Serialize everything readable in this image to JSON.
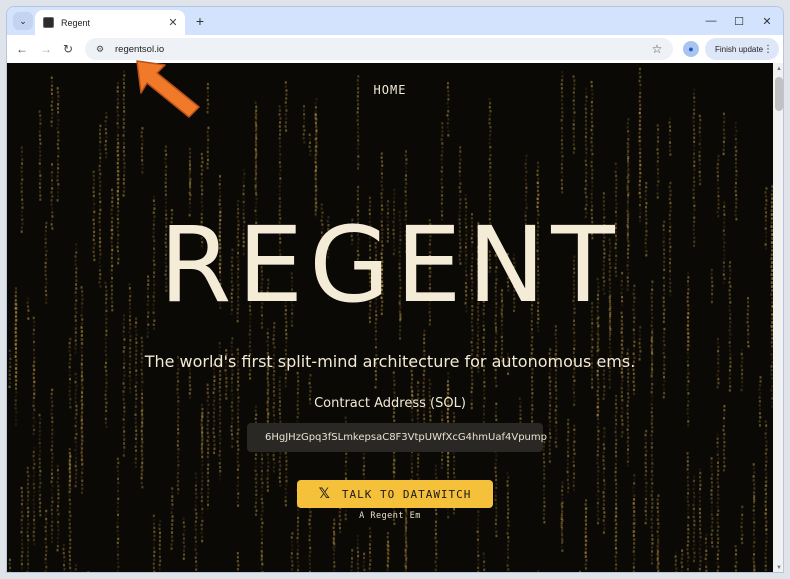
{
  "browser": {
    "tab_title": "Regent",
    "url": "regentsol.io",
    "finish_update_label": "Finish update",
    "icons": {
      "tab_search": "chevron-down-icon",
      "new_tab": "plus-icon",
      "back": "arrow-left-icon",
      "forward": "arrow-right-icon",
      "reload": "reload-icon",
      "site_settings": "tune-icon",
      "bookmark": "star-icon",
      "profile": "person-icon",
      "menu": "kebab-icon"
    }
  },
  "page": {
    "nav_home": "HOME",
    "title": "REGENT",
    "tagline": "The world's first split-mind architecture for autonomous ems.",
    "contract_label": "Contract Address (SOL)",
    "contract_address": "6HgJHzGpq3fSLmkepsaC8F3VtpUWfXcG4hmUaf4Vpump",
    "cta_label": "TALK TO DATAWITCH",
    "cta_sub": "A Regent Em"
  },
  "colors": {
    "background": "#0b0905",
    "rain": "#c9a24a",
    "cta": "#f5c13a",
    "text": "#f5ecd8",
    "annotation_arrow": "#f07a2a"
  }
}
